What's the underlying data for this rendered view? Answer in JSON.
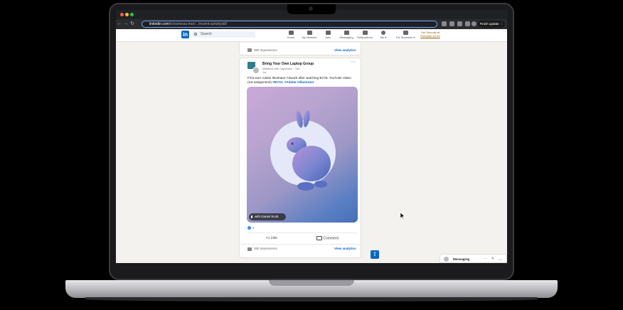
{
  "browser": {
    "url_host": "linkedin.com",
    "url_path": "/in/vanessa-tran/.../recent-activity/all/",
    "finish_update_label": "Finish update",
    "back_glyph": "←",
    "forward_glyph": "→",
    "reload_glyph": "↻",
    "more_glyph": "⋮"
  },
  "linkedin": {
    "logo_text": "in",
    "search_placeholder": "Search",
    "nav": [
      {
        "label": "Home",
        "icon": "home-icon"
      },
      {
        "label": "My Network",
        "icon": "network-icon"
      },
      {
        "label": "Jobs",
        "icon": "jobs-icon"
      },
      {
        "label": "Messaging",
        "icon": "messaging-icon"
      },
      {
        "label": "Notifications",
        "icon": "bell-icon"
      },
      {
        "label": "Me ▾",
        "icon": "avatar-icon"
      },
      {
        "label": "For Business ▾",
        "icon": "grid-icon"
      }
    ],
    "promo_line1": "Get Security at",
    "promo_line2": "Premium for £0"
  },
  "feed": {
    "top_impressions": "960 impressions",
    "view_analytics": "View analytics",
    "post": {
      "group_name": "Bring Your Own Laptop Group",
      "author_line": "Matthew with Jaywinker · Tue",
      "time": "1w · ",
      "more": "···",
      "text_main": "First ever Adobe Illustrator Artwork after watching BYOL YouTube Video (1st assignment) ",
      "text_tags": "#BYOL #Adobe #Illustrator",
      "chip_label": "with Daniel Scott",
      "reaction_count": "4",
      "like_label": "Like",
      "comment_label": "Comment",
      "impressions": "260 impressions",
      "view_analytics": "View analytics"
    }
  },
  "messaging": {
    "label": "Messaging",
    "more": "···",
    "compose": "✎",
    "collapse": "︿"
  },
  "scroll_top_glyph": "⇧"
}
